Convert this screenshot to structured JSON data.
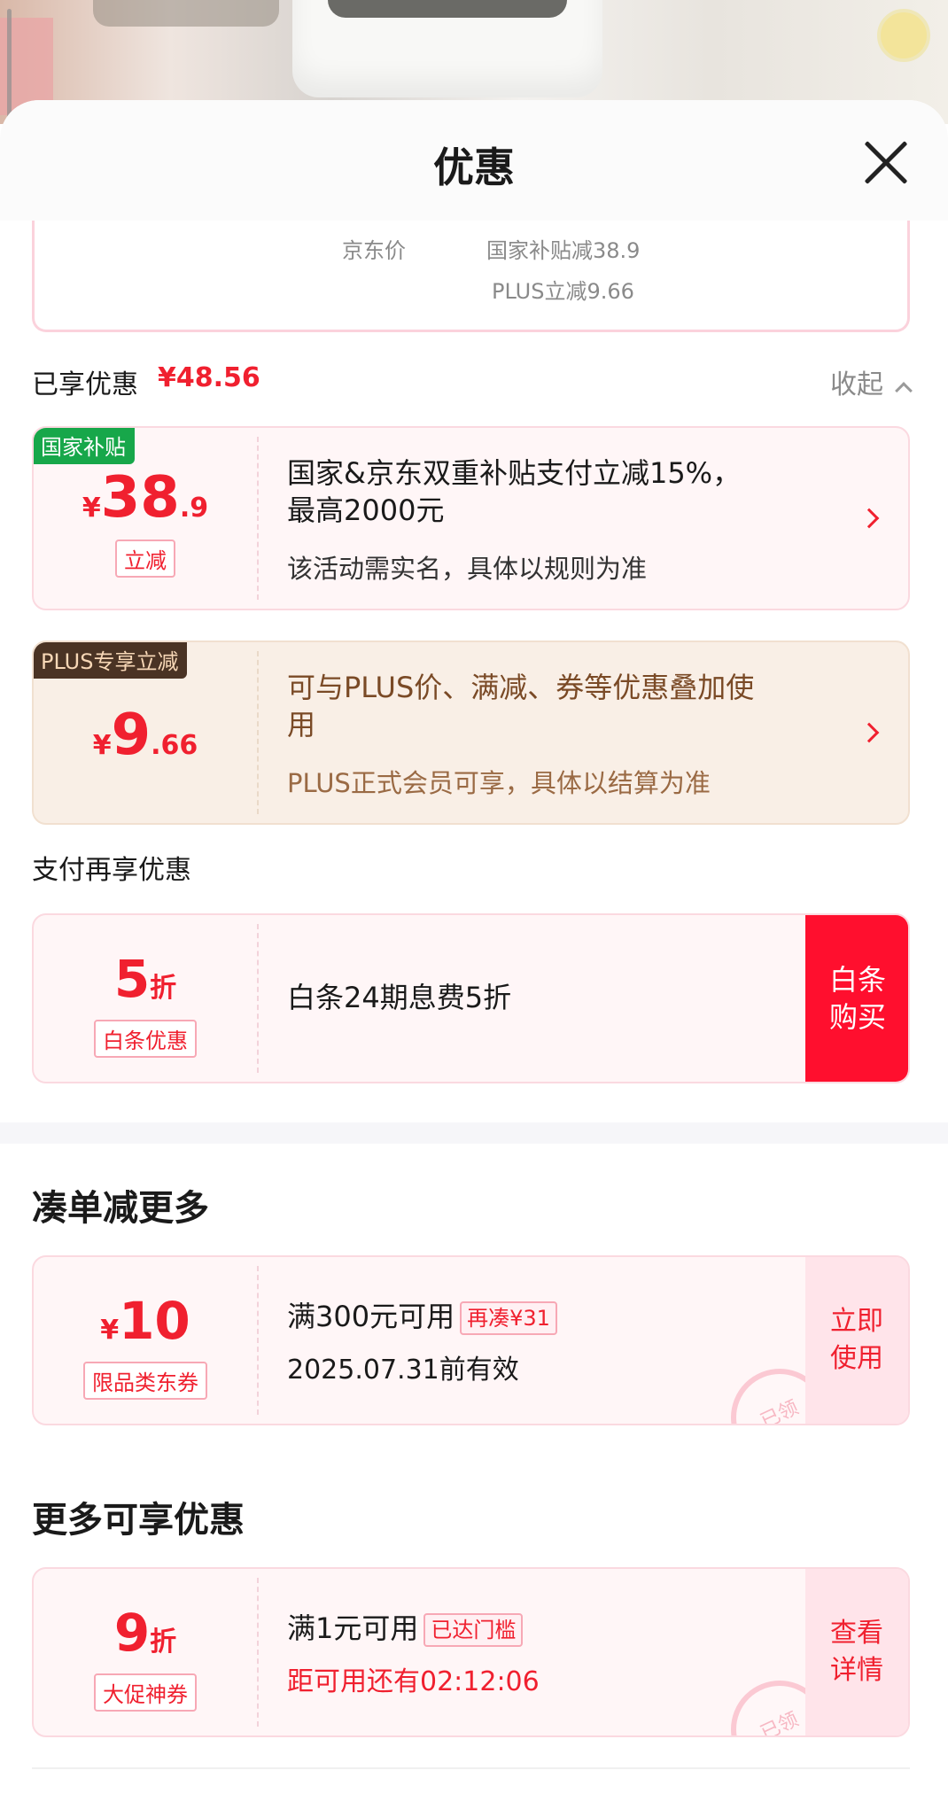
{
  "sheet": {
    "title": "优惠"
  },
  "price_box": {
    "jd_price_label": "京东价",
    "subsidy_label": "国家补贴减38.9",
    "plus_label": "PLUS立减9.66"
  },
  "enjoyed": {
    "label": "已享优惠",
    "amount": "¥48.56",
    "collapse_label": "收起"
  },
  "subsidy_card": {
    "tag": "国家补贴",
    "yen": "¥",
    "int": "38",
    "dec": ".9",
    "sub_tag": "立减",
    "line1": "国家&京东双重补贴支付立减15%，",
    "line2": "最高2000元",
    "note": "该活动需实名，具体以规则为准"
  },
  "plus_card": {
    "tag": "PLUS专享立减",
    "yen": "¥",
    "int": "9",
    "dec": ".66",
    "line1": "可与PLUS价、满减、券等优惠叠加使",
    "line2": "用",
    "note": "PLUS正式会员可享，具体以结算为准"
  },
  "payment_section": {
    "label": "支付再享优惠"
  },
  "baitiao_card": {
    "int": "5",
    "unit": "折",
    "sub_tag": "白条优惠",
    "text": "白条24期息费5折",
    "button_line1": "白条",
    "button_line2": "购买"
  },
  "bundle_section": {
    "title": "凑单减更多"
  },
  "coupon_card": {
    "yen": "¥",
    "int": "10",
    "sub_tag": "限品类东券",
    "line1": "满300元可用",
    "inline_tag": "再凑¥31",
    "line2": "2025.07.31前有效",
    "stamp": "已领",
    "button_line1": "立即",
    "button_line2": "使用"
  },
  "more_section": {
    "title": "更多可享优惠"
  },
  "promo_card": {
    "int": "9",
    "unit": "折",
    "sub_tag": "大促神券",
    "line1": "满1元可用",
    "inline_tag": "已达门槛",
    "line2": "距可用还有02:12:06",
    "stamp": "已领",
    "button_line1": "查看",
    "button_line2": "详情"
  },
  "colors": {
    "accent_red": "#f0202f",
    "green_tag": "#17a74a",
    "plus_brown": "#4a3324"
  }
}
